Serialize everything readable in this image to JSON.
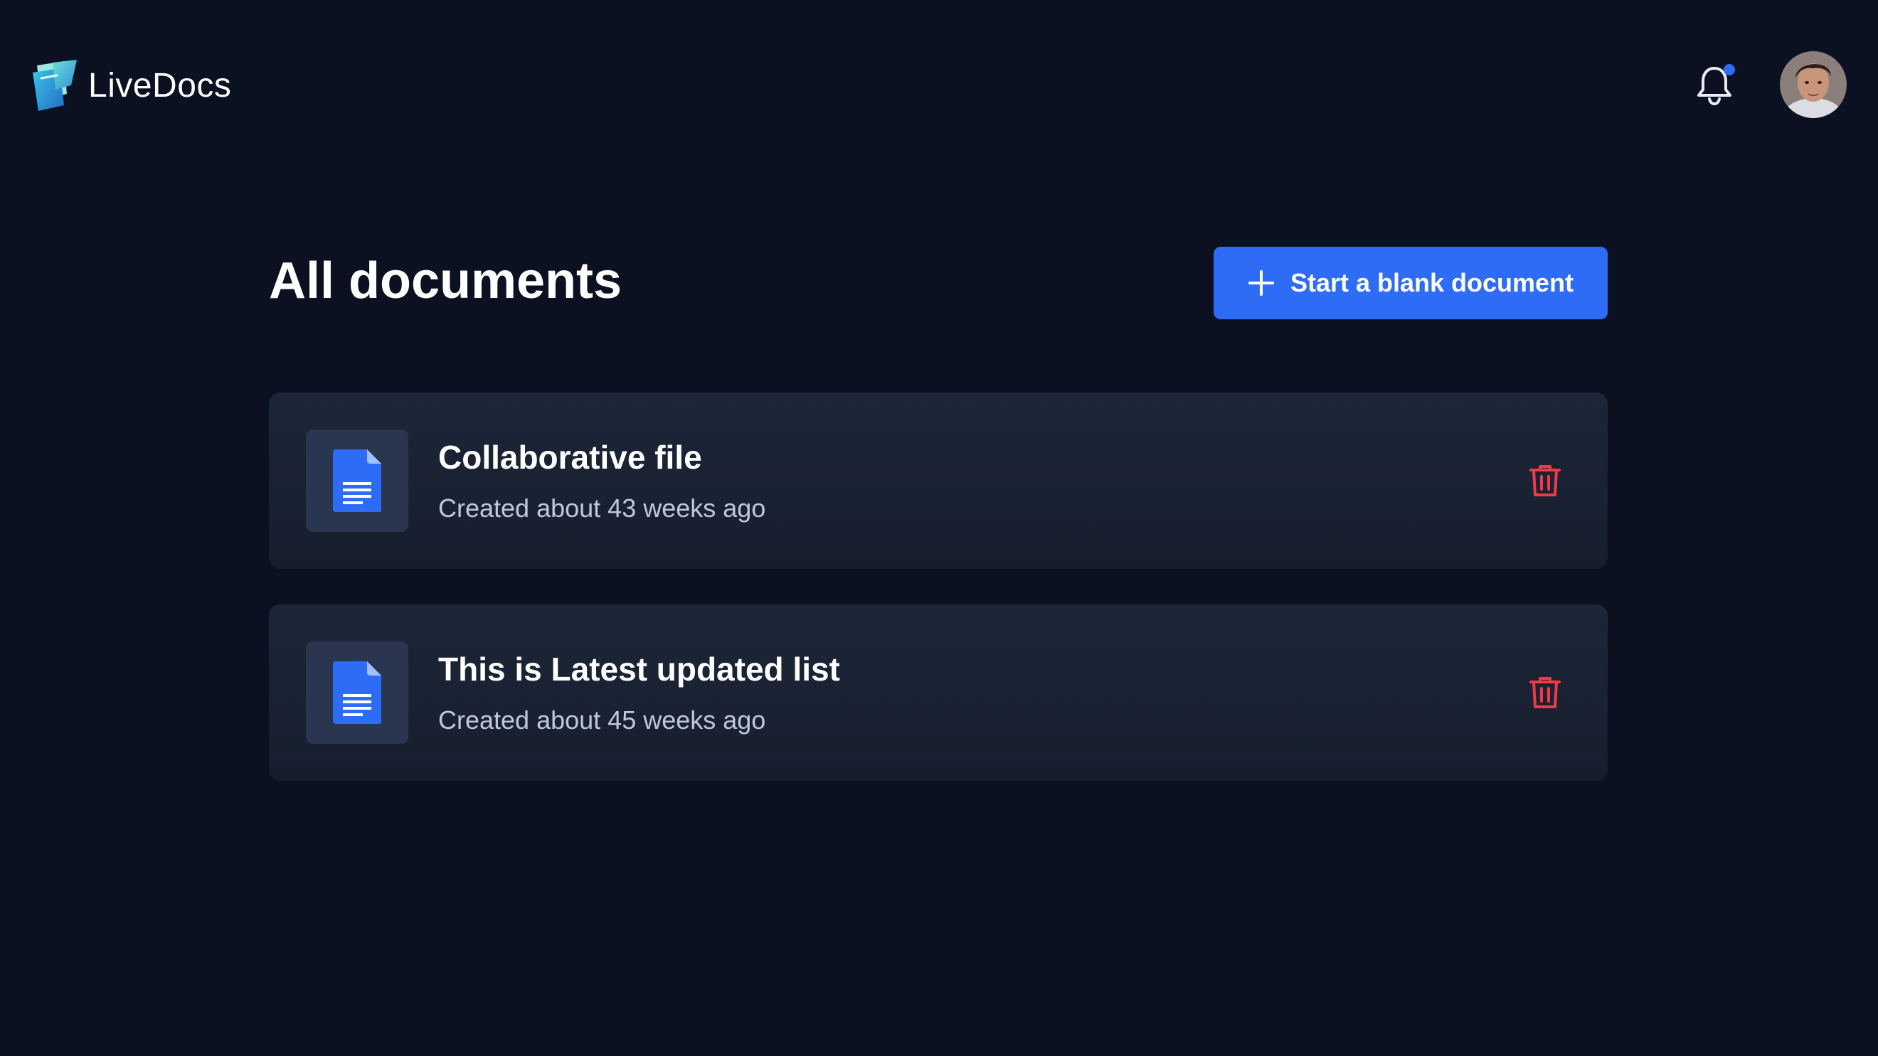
{
  "app": {
    "name": "LiveDocs"
  },
  "header": {
    "notification_dot_color": "#2f6cf6",
    "avatar": "user-avatar"
  },
  "main": {
    "title": "All documents",
    "new_document_button": "Start a blank document",
    "documents": [
      {
        "title": "Collaborative file",
        "meta": "Created about 43 weeks ago"
      },
      {
        "title": "This is Latest updated list",
        "meta": "Created about 45 weeks ago"
      }
    ]
  },
  "icons": {
    "logo": "livedocs-logo-icon",
    "bell": "bell-icon",
    "plus": "plus-icon",
    "document": "document-icon",
    "delete": "trash-icon"
  },
  "colors": {
    "background": "#0b1120",
    "card": "#1a2233",
    "accent": "#2f6cf6",
    "danger": "#ef3b46",
    "muted_text": "#c0c8df"
  }
}
